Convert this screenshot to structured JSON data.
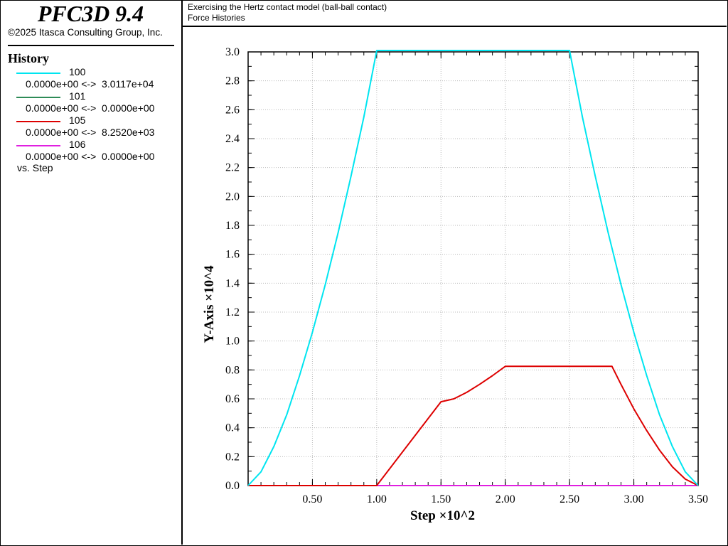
{
  "app": {
    "title": "PFC3D 9.4",
    "copyright": "©2025 Itasca Consulting Group, Inc."
  },
  "header": {
    "line1": "Exercising the Hertz contact model (ball-ball contact)",
    "line2": "Force Histories"
  },
  "legend": {
    "heading": "History",
    "entries": [
      {
        "id": "100",
        "color": "#00e5f0",
        "range": "0.0000e+00 <->  3.0117e+04"
      },
      {
        "id": "101",
        "color": "#2e8b57",
        "range": "0.0000e+00 <->  0.0000e+00"
      },
      {
        "id": "105",
        "color": "#dd0000",
        "range": "0.0000e+00 <->  8.2520e+03"
      },
      {
        "id": "106",
        "color": "#e020e0",
        "range": "0.0000e+00 <->  0.0000e+00"
      }
    ],
    "vs": "vs. Step"
  },
  "chart_data": {
    "type": "line",
    "xlabel": "Step ×10^2",
    "ylabel": "Y-Axis ×10^4",
    "xlim": [
      0.0,
      3.5
    ],
    "ylim": [
      0.0,
      3.0
    ],
    "x_ticks": [
      "0.50",
      "1.00",
      "1.50",
      "2.00",
      "2.50",
      "3.00",
      "3.50"
    ],
    "y_ticks": [
      "0.0",
      "0.2",
      "0.4",
      "0.6",
      "0.8",
      "1.0",
      "1.2",
      "1.4",
      "1.6",
      "1.8",
      "2.0",
      "2.2",
      "2.4",
      "2.6",
      "2.8",
      "3.0"
    ],
    "grid": true,
    "series": [
      {
        "name": "100",
        "color": "#00e5f0",
        "x": [
          0.0,
          0.1,
          0.2,
          0.3,
          0.4,
          0.5,
          0.6,
          0.7,
          0.8,
          0.9,
          1.0,
          1.5,
          2.0,
          2.5,
          2.6,
          2.7,
          2.8,
          2.9,
          3.0,
          3.1,
          3.2,
          3.3,
          3.4,
          3.5
        ],
        "y": [
          0.0,
          0.095,
          0.27,
          0.49,
          0.76,
          1.06,
          1.39,
          1.75,
          2.14,
          2.55,
          3.01,
          3.01,
          3.01,
          3.01,
          2.55,
          2.14,
          1.75,
          1.39,
          1.06,
          0.76,
          0.49,
          0.27,
          0.095,
          0.0
        ]
      },
      {
        "name": "101",
        "color": "#2e8b57",
        "x": [
          0.0,
          3.5
        ],
        "y": [
          0.0,
          0.0
        ]
      },
      {
        "name": "105",
        "color": "#dd0000",
        "x": [
          0.0,
          1.0,
          1.5,
          1.6,
          1.7,
          1.8,
          1.9,
          2.0,
          2.83,
          2.9,
          3.0,
          3.1,
          3.2,
          3.3,
          3.4,
          3.5
        ],
        "y": [
          0.0,
          0.0,
          0.58,
          0.6,
          0.645,
          0.7,
          0.76,
          0.825,
          0.825,
          0.7,
          0.53,
          0.38,
          0.245,
          0.13,
          0.045,
          0.0
        ]
      },
      {
        "name": "106",
        "color": "#e020e0",
        "x": [
          0.0,
          3.5
        ],
        "y": [
          0.0,
          0.0
        ]
      }
    ]
  }
}
